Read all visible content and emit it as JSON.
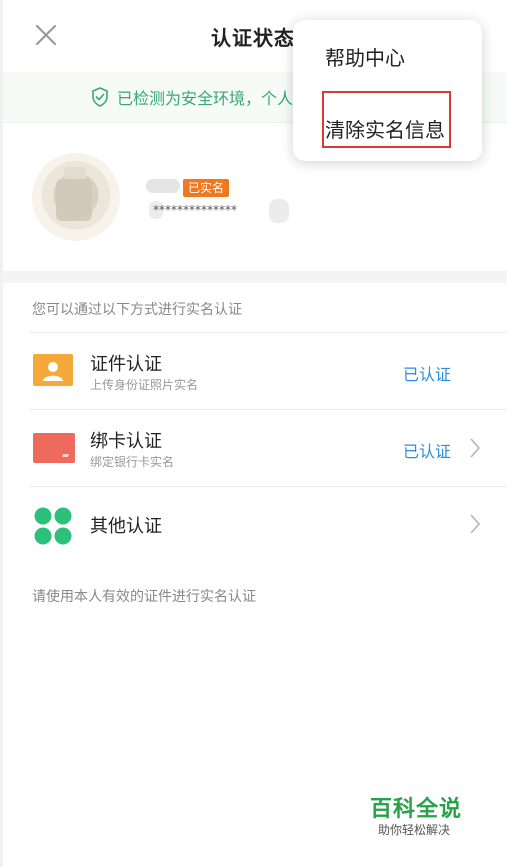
{
  "header": {
    "title": "认证状态"
  },
  "banner": {
    "text": "已检测为安全环境，个人"
  },
  "profile": {
    "badge": "已实名",
    "id_masked": "**************"
  },
  "section_hint": "您可以通过以下方式进行实名认证",
  "methods": [
    {
      "title": "证件认证",
      "subtitle": "上传身份证照片实名",
      "status": "已认证",
      "icon": "id-card-icon",
      "color": "#f5a93a"
    },
    {
      "title": "绑卡认证",
      "subtitle": "绑定银行卡实名",
      "status": "已认证",
      "icon": "bank-card-icon",
      "color": "#ee6a5c"
    },
    {
      "title": "其他认证",
      "subtitle": "",
      "status": "",
      "icon": "grid-dots-icon",
      "color": "#2cc17b"
    }
  ],
  "footer_hint": "请使用本人有效的证件进行实名认证",
  "menu": {
    "items": [
      "帮助中心",
      "清除实名信息"
    ]
  },
  "watermark": {
    "title": "百科全说",
    "subtitle": "助你轻松解决"
  },
  "colors": {
    "accent_blue": "#2a8de0",
    "safe_green": "#3aa675",
    "badge_orange": "#f07820",
    "highlight_red": "#d43a3a"
  }
}
